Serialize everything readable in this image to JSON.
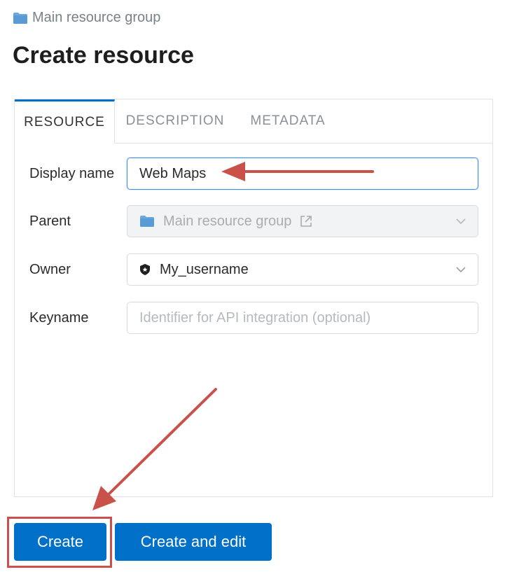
{
  "breadcrumb": {
    "label": "Main resource group",
    "icon": "folder-icon"
  },
  "page_title": "Create resource",
  "tabs": [
    {
      "label": "RESOURCE",
      "active": true
    },
    {
      "label": "DESCRIPTION",
      "active": false
    },
    {
      "label": "METADATA",
      "active": false
    }
  ],
  "form": {
    "display_name": {
      "label": "Display name",
      "value": "Web Maps"
    },
    "parent": {
      "label": "Parent",
      "value": "Main resource group",
      "disabled": true
    },
    "owner": {
      "label": "Owner",
      "value": "My_username"
    },
    "keyname": {
      "label": "Keyname",
      "placeholder": "Identifier for API integration (optional)",
      "value": ""
    }
  },
  "buttons": {
    "create": "Create",
    "create_and_edit": "Create and edit"
  },
  "colors": {
    "primary": "#0070c9",
    "annotation": "#c9514a",
    "folder": "#5b9bd5"
  }
}
